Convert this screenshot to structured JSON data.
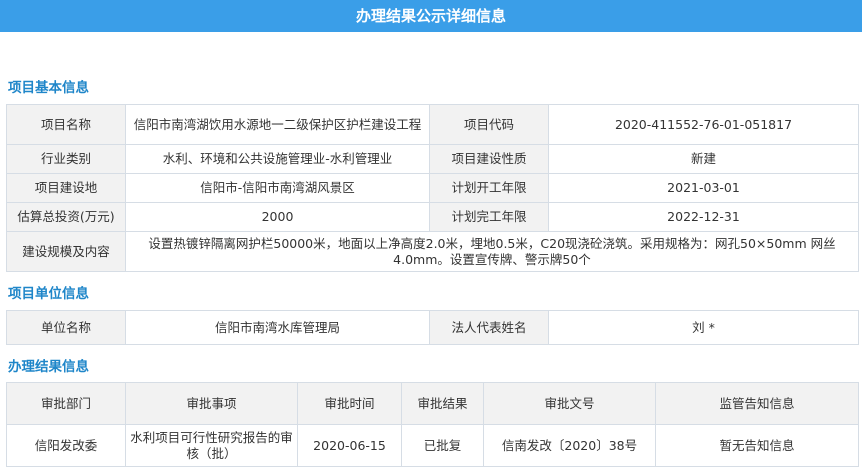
{
  "page_title": "办理结果公示详细信息",
  "basic": {
    "title": "项目基本信息",
    "name_label": "项目名称",
    "name_value": "信阳市南湾湖饮用水源地一二级保护区护栏建设工程",
    "code_label": "项目代码",
    "code_value": "2020-411552-76-01-051817",
    "industry_label": "行业类别",
    "industry_value": "水利、环境和公共设施管理业-水利管理业",
    "nature_label": "项目建设性质",
    "nature_value": "新建",
    "location_label": "项目建设地",
    "location_value": "信阳市-信阳市南湾湖风景区",
    "start_label": "计划开工年限",
    "start_value": "2021-03-01",
    "invest_label": "估算总投资(万元)",
    "invest_value": "2000",
    "end_label": "计划完工年限",
    "end_value": "2022-12-31",
    "scale_label": "建设规模及内容",
    "scale_value": "设置热镀锌隔离网护栏50000米，地面以上净高度2.0米，埋地0.5米，C20现浇砼浇筑。采用规格为：网孔50×50mm 网丝4.0mm。设置宣传牌、警示牌50个"
  },
  "unit": {
    "title": "项目单位信息",
    "unit_label": "单位名称",
    "unit_value": "信阳市南湾水库管理局",
    "rep_label": "法人代表姓名",
    "rep_value": "刘 *"
  },
  "result": {
    "title": "办理结果信息",
    "headers": [
      "审批部门",
      "审批事项",
      "审批时间",
      "审批结果",
      "审批文号",
      "监管告知信息"
    ],
    "rows": [
      [
        "信阳发改委",
        "水利项目可行性研究报告的审核（批）",
        "2020-06-15",
        "已批复",
        "信南发改〔2020〕38号",
        "暂无告知信息"
      ]
    ]
  }
}
